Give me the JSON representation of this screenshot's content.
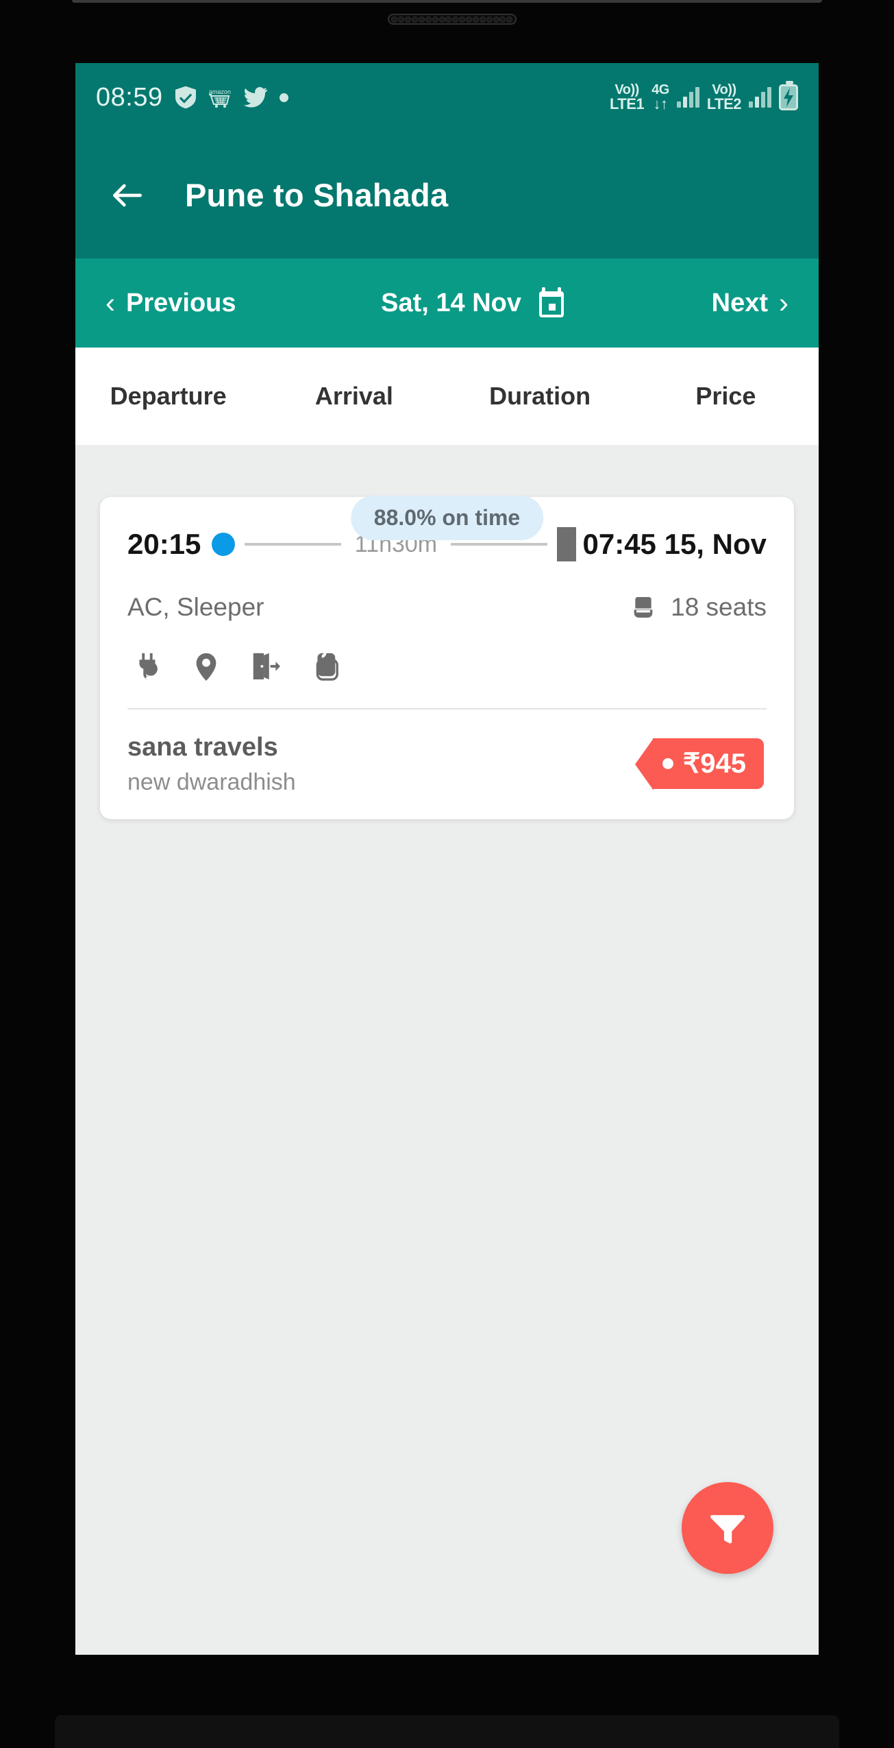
{
  "statusbar": {
    "clock": "08:59",
    "left_icons": [
      "shield-check-icon",
      "amazon-cart-icon",
      "twitter-bird-icon",
      "dot-icon"
    ],
    "sim1_top": "Vo))",
    "sim1_bottom": "LTE1",
    "data_top": "4G",
    "data_bottom": "↓↑",
    "sim2_top": "Vo))",
    "sim2_bottom": "LTE2",
    "battery": "charging"
  },
  "appbar": {
    "back_label": "back-arrow",
    "title": "Pune to Shahada",
    "background_color": "#04786e"
  },
  "datebar": {
    "previous_label": "Previous",
    "previous_chevron": "‹",
    "date": "Sat, 14 Nov",
    "calendar_icon": "calendar-icon",
    "next_label": "Next",
    "next_chevron": "›",
    "background_color": "#0a9b87"
  },
  "sort_tabs": [
    {
      "label": "Departure"
    },
    {
      "label": "Arrival"
    },
    {
      "label": "Duration"
    },
    {
      "label": "Price"
    }
  ],
  "results": [
    {
      "ontime_badge": "88.0% on time",
      "departure_time": "20:15",
      "duration": "11h30m",
      "arrival_time": "07:45 15, Nov",
      "bus_class": "AC, Sleeper",
      "seats": "18 seats",
      "amenities": [
        "charging-point-icon",
        "live-tracking-icon",
        "boarding-exit-icon",
        "blanket-icon"
      ],
      "operator_name": "sana travels",
      "operator_sub": "new dwaradhish",
      "price": "₹945",
      "price_color": "#fb5b52"
    }
  ],
  "filter_fab": {
    "icon": "filter-funnel-icon",
    "color": "#fb5b52"
  },
  "navbar": {
    "recents": "recents-button",
    "home": "home-button",
    "back": "‹"
  }
}
